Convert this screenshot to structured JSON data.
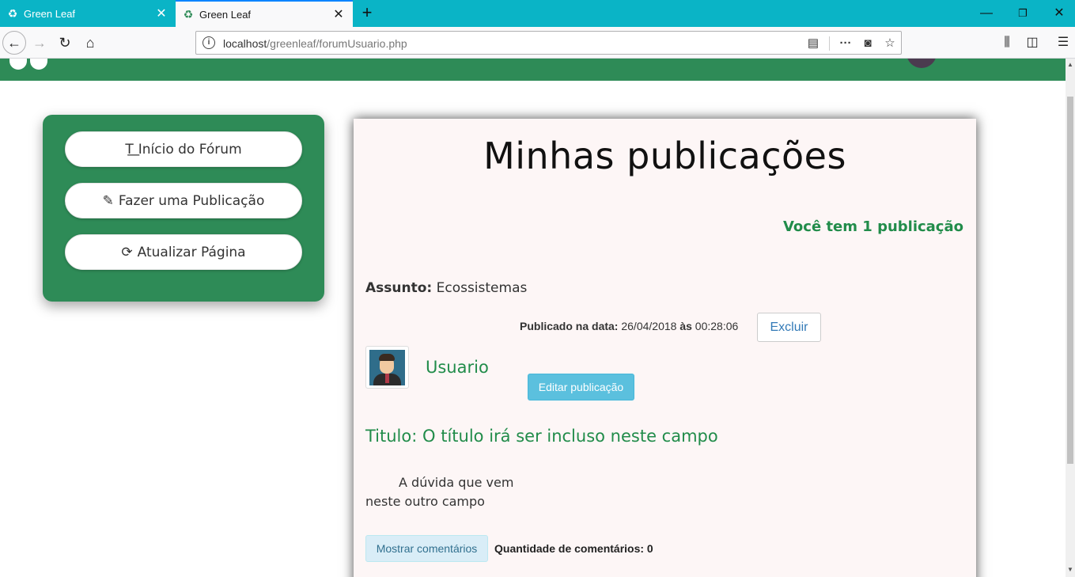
{
  "browser": {
    "tabs": [
      {
        "title": "Green Leaf",
        "active": false
      },
      {
        "title": "Green Leaf",
        "active": true
      }
    ],
    "url": {
      "host": "localhost",
      "path": "/greenleaf/forumUsuario.php"
    },
    "icons": {
      "tab_favicon": "recycle-icon",
      "close": "close-icon",
      "new_tab": "plus-icon",
      "back": "back-arrow-icon",
      "forward": "forward-arrow-icon",
      "reload": "reload-icon",
      "home": "home-icon",
      "site_info": "info-icon",
      "reader": "reader-view-icon",
      "more": "more-actions-icon",
      "pocket": "pocket-icon",
      "bookmark": "star-icon",
      "library": "library-icon",
      "sidebar": "sidebar-icon",
      "menu": "hamburger-menu-icon"
    }
  },
  "colors": {
    "brand_green": "#2e8b57",
    "text_green": "#218c4a",
    "tab_bar": "#0ab4c6",
    "info_button": "#5bc0de",
    "link_blue": "#337ab7"
  },
  "sidebar": {
    "items": [
      {
        "label": "Início do Fórum",
        "icon": "text-height-icon"
      },
      {
        "label": "Fazer uma Publicação",
        "icon": "pencil-icon"
      },
      {
        "label": "Atualizar Página",
        "icon": "refresh-icon"
      }
    ]
  },
  "main": {
    "title": "Minhas publicações",
    "publication_count_text": "Você tem 1 publicação",
    "post": {
      "subject_label": "Assunto:",
      "subject_value": "Ecossistemas",
      "published_label": "Publicado na data:",
      "published_date": "26/04/2018",
      "at_label": "às",
      "published_time": "00:28:06",
      "delete_label": "Excluir",
      "author": "Usuario",
      "edit_label": "Editar publicação",
      "title_label": "Titulo:",
      "title_value": "O título irá ser incluso neste campo",
      "body": "A dúvida que vem neste outro campo",
      "show_comments_label": "Mostrar comentários",
      "comments_count_label": "Quantidade de comentários: 0"
    }
  }
}
